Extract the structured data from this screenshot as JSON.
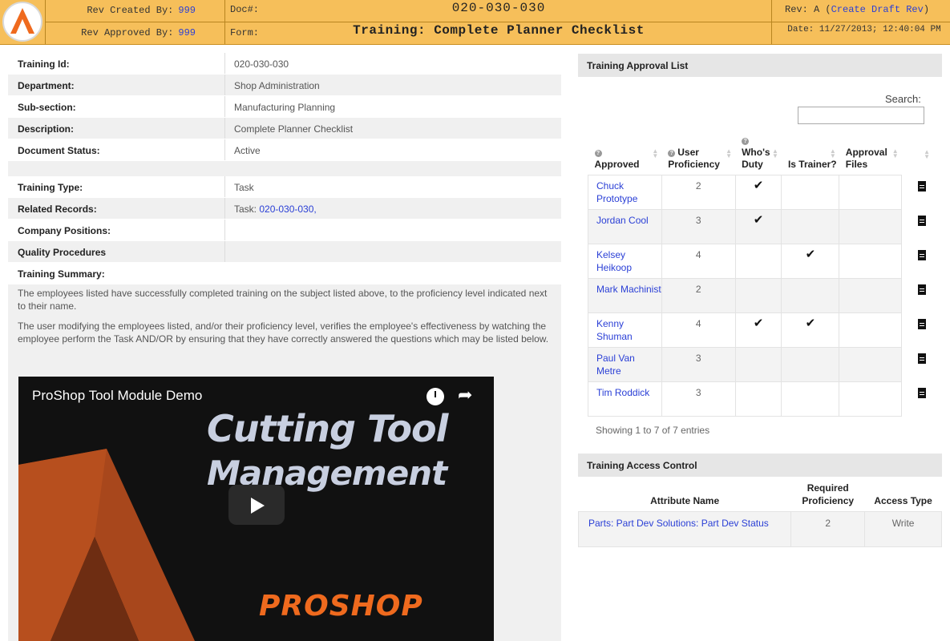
{
  "header": {
    "rev_created_label": "Rev Created By:",
    "rev_created_value": "999",
    "rev_approved_label": "Rev Approved By:",
    "rev_approved_value": "999",
    "doc_label": "Doc#:",
    "doc_number": "020-030-030",
    "form_label": "Form:",
    "form_title": "Training: Complete Planner Checklist",
    "rev_label": "Rev: A (",
    "rev_link": "Create Draft Rev",
    "rev_close": ")",
    "date_text": "Date: 11/27/2013; 12:40:04 PM"
  },
  "fields": [
    {
      "label": "Training Id:",
      "value": "020-030-030"
    },
    {
      "label": "Department:",
      "value": "Shop Administration"
    },
    {
      "label": "Sub-section:",
      "value": "Manufacturing Planning"
    },
    {
      "label": "Description:",
      "value": "Complete Planner Checklist"
    },
    {
      "label": "Document Status:",
      "value": "Active"
    },
    {
      "label": "Training Type:",
      "value": "Task"
    },
    {
      "label": "Related Records:",
      "value_prefix": "Task: ",
      "value_link": "020-030-030,"
    },
    {
      "label": "Company Positions:",
      "value": ""
    },
    {
      "label": "Quality Procedures",
      "value": ""
    },
    {
      "label": "Training Summary:",
      "value": ""
    }
  ],
  "summary": {
    "p1": "The employees listed have successfully completed training on the subject listed above, to the proficiency level indicated next to their name.",
    "p2": "The user modifying the employees listed, and/or their proficiency level, verifies the employee's effectiveness by watching the employee perform the Task AND/OR by ensuring that they have correctly answered the questions which may be listed below."
  },
  "video": {
    "title": "ProShop Tool Module Demo",
    "headline_1": "Cutting Tool",
    "headline_2": "Management",
    "brand": "PROSHOP",
    "clock_icon": "clock-icon",
    "share_icon": "share-icon",
    "play_icon": "play-icon"
  },
  "approval": {
    "title": "Training Approval List",
    "search_label": "Search:",
    "search_value": "",
    "columns": [
      "Approved",
      "User Proficiency",
      "Who's Duty",
      "Is Trainer?",
      "Approval Files"
    ],
    "rows": [
      {
        "name": "Chuck Prototype",
        "proficiency": "2",
        "duty": "✔",
        "trainer": ""
      },
      {
        "name": "Jordan Cool",
        "proficiency": "3",
        "duty": "✔",
        "trainer": ""
      },
      {
        "name": "Kelsey Heikoop",
        "proficiency": "4",
        "duty": "",
        "trainer": "✔"
      },
      {
        "name": "Mark Machinist",
        "proficiency": "2",
        "duty": "",
        "trainer": ""
      },
      {
        "name": "Kenny Shuman",
        "proficiency": "4",
        "duty": "✔",
        "trainer": "✔"
      },
      {
        "name": "Paul Van Metre",
        "proficiency": "3",
        "duty": "",
        "trainer": ""
      },
      {
        "name": "Tim Roddick",
        "proficiency": "3",
        "duty": "",
        "trainer": ""
      }
    ],
    "showing": "Showing 1 to 7 of 7 entries"
  },
  "access": {
    "title": "Training Access Control",
    "columns": [
      "Attribute Name",
      "Required Proficiency",
      "Access Type"
    ],
    "rows": [
      {
        "attribute": "Parts: Part Dev Solutions: Part Dev Status",
        "proficiency": "2",
        "access": "Write"
      }
    ]
  },
  "colors": {
    "header_bg": "#f6bf5a",
    "link": "#2a3fd6",
    "brand_orange": "#ef6a1e"
  }
}
